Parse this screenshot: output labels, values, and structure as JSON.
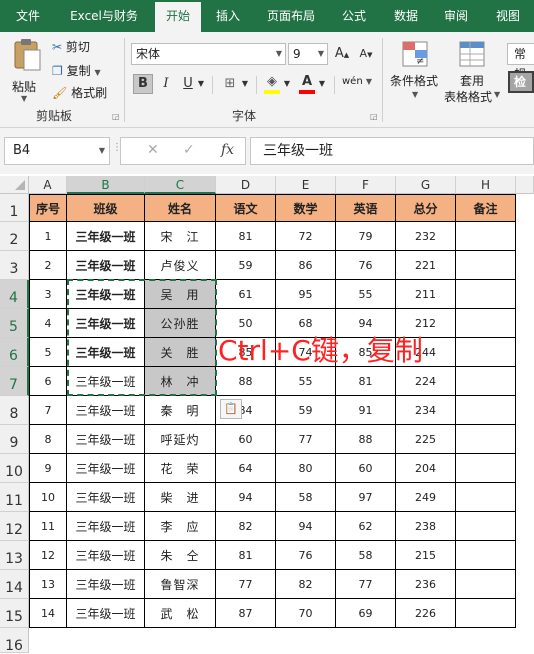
{
  "tabs": [
    "文件",
    "Excel与财务",
    "开始",
    "插入",
    "页面布局",
    "公式",
    "数据",
    "审阅",
    "视图"
  ],
  "active_tab": "开始",
  "clipboard": {
    "paste_label": "粘贴",
    "cut_label": "剪切",
    "copy_label": "复制",
    "format_painter_label": "格式刷",
    "group_label": "剪贴板"
  },
  "font": {
    "font_name": "宋体",
    "font_size": "9",
    "grow_label": "A",
    "shrink_label": "A",
    "bold_label": "B",
    "italic_label": "I",
    "underline_label": "U",
    "phonetic_label": "wén",
    "group_label": "字体"
  },
  "styles": {
    "conditional_format_label": "条件格式",
    "table_format_label_1": "套用",
    "table_format_label_2": "表格格式",
    "number_format": "常规",
    "check_label": "检"
  },
  "formula_bar": {
    "name_box": "B4",
    "fx_label": "fx",
    "formula": "三年级一班"
  },
  "columns": [
    "A",
    "B",
    "C",
    "D",
    "E",
    "F",
    "G",
    "H"
  ],
  "rows": [
    "1",
    "2",
    "3",
    "4",
    "5",
    "6",
    "7",
    "8",
    "9",
    "10",
    "11",
    "12",
    "13",
    "14",
    "15",
    "16"
  ],
  "table": {
    "headers": [
      "序号",
      "班级",
      "姓名",
      "语文",
      "数学",
      "英语",
      "总分",
      "备注"
    ],
    "rows": [
      [
        "1",
        "三年级一班",
        "宋　江",
        "81",
        "72",
        "79",
        "232",
        ""
      ],
      [
        "2",
        "三年级一班",
        "卢俊义",
        "59",
        "86",
        "76",
        "221",
        ""
      ],
      [
        "3",
        "三年级一班",
        "吴　用",
        "61",
        "95",
        "55",
        "211",
        ""
      ],
      [
        "4",
        "三年级一班",
        "公孙胜",
        "50",
        "68",
        "94",
        "212",
        ""
      ],
      [
        "5",
        "三年级一班",
        "关　胜",
        "85",
        "74",
        "85",
        "244",
        ""
      ],
      [
        "6",
        "三年级一班",
        "林　冲",
        "88",
        "55",
        "81",
        "224",
        ""
      ],
      [
        "7",
        "三年级一班",
        "秦　明",
        "84",
        "59",
        "91",
        "234",
        ""
      ],
      [
        "8",
        "三年级一班",
        "呼延灼",
        "60",
        "77",
        "88",
        "225",
        ""
      ],
      [
        "9",
        "三年级一班",
        "花　荣",
        "64",
        "80",
        "60",
        "204",
        ""
      ],
      [
        "10",
        "三年级一班",
        "柴　进",
        "94",
        "58",
        "97",
        "249",
        ""
      ],
      [
        "11",
        "三年级一班",
        "李　应",
        "82",
        "94",
        "62",
        "238",
        ""
      ],
      [
        "12",
        "三年级一班",
        "朱　仝",
        "81",
        "76",
        "58",
        "215",
        ""
      ],
      [
        "13",
        "三年级一班",
        "鲁智深",
        "77",
        "82",
        "77",
        "236",
        ""
      ],
      [
        "14",
        "三年级一班",
        "武　松",
        "87",
        "70",
        "69",
        "226",
        ""
      ]
    ]
  },
  "overlay_text": "Ctrl+C键，复制",
  "colors": {
    "brand_green": "#217346",
    "header_fill": "#f4b183",
    "selection_fill": "#c8c8c8",
    "overlay_red": "#ff2222"
  }
}
